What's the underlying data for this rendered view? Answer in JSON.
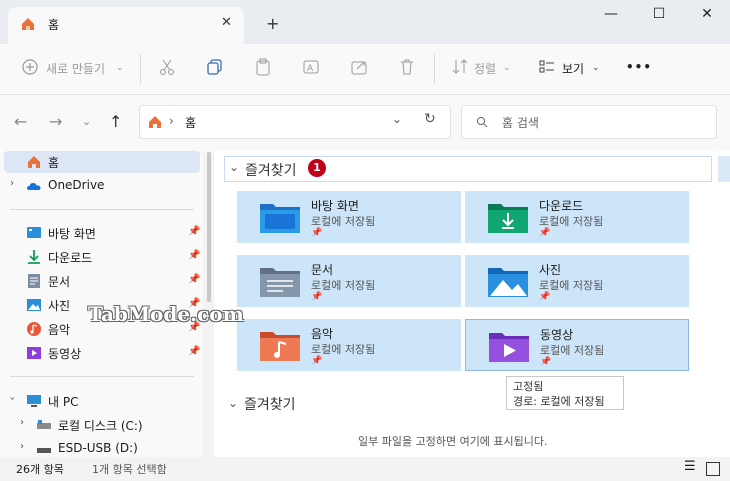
{
  "window": {
    "tab_title": "홈",
    "close_tab": "✕",
    "new_tab": "+",
    "minimize": "—",
    "maximize": "☐",
    "close": "✕"
  },
  "toolbar": {
    "new_label": "새로 만들기",
    "sort_label": "정렬",
    "view_label": "보기",
    "more_label": "•••"
  },
  "address": {
    "current": "홈",
    "search_placeholder": "홈 검색"
  },
  "sidebar": {
    "home": "홈",
    "onedrive": "OneDrive",
    "pinned": [
      {
        "label": "바탕 화면"
      },
      {
        "label": "다운로드"
      },
      {
        "label": "문서"
      },
      {
        "label": "사진"
      },
      {
        "label": "음악"
      },
      {
        "label": "동영상"
      }
    ],
    "this_pc": "내 PC",
    "drives": [
      {
        "label": "로컬 디스크 (C:)"
      },
      {
        "label": "ESD-USB (D:)"
      }
    ]
  },
  "content": {
    "favorites_title": "즐겨찾기",
    "badge": "1",
    "tiles": [
      {
        "name": "바탕 화면",
        "sub": "로컬에 저장됨"
      },
      {
        "name": "다운로드",
        "sub": "로컬에 저장됨"
      },
      {
        "name": "문서",
        "sub": "로컬에 저장됨"
      },
      {
        "name": "사진",
        "sub": "로컬에 저장됨"
      },
      {
        "name": "음악",
        "sub": "로컬에 저장됨"
      },
      {
        "name": "동영상",
        "sub": "로컬에 저장됨"
      }
    ],
    "tooltip_line1": "고정됨",
    "tooltip_line2": "경로: 로컬에 저장됨",
    "favorites2_title": "즐겨찾기",
    "empty_text": "일부 파일을 고정하면 여기에 표시됩니다."
  },
  "status": {
    "item_count": "26개 항목",
    "selected": "1개 항목 선택함"
  },
  "watermark": "TabMode.com",
  "colors": {
    "accent": "#0067c0",
    "selection": "#cce5f9",
    "badge": "#c0001a"
  }
}
